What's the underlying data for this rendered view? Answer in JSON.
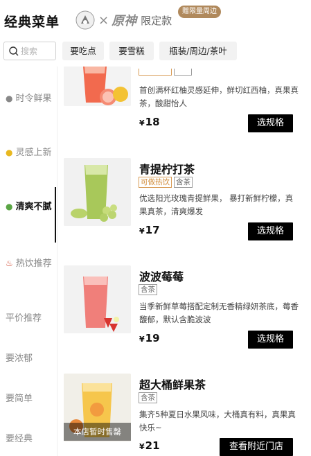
{
  "header": {
    "title": "经典菜单",
    "collab_x": "×",
    "collab_brand": "原神",
    "limited": "限定款",
    "gift_badge": "赠限量周边"
  },
  "search": {
    "placeholder": "搜索"
  },
  "filters": [
    "要吃点",
    "要雪糕",
    "瓶装/周边/茶叶"
  ],
  "sidebar": {
    "items": [
      {
        "label": "时令鲜果",
        "icon": "coconut-icon"
      },
      {
        "label": "灵感上新",
        "icon": "lightbulb-icon"
      },
      {
        "label": "清爽不腻",
        "icon": "leaf-icon",
        "active": true
      },
      {
        "label": "热饮推荐",
        "icon": "hot-steam-icon"
      },
      {
        "label": "平价推荐"
      },
      {
        "label": "要浓郁"
      },
      {
        "label": "要简单"
      },
      {
        "label": "要经典"
      }
    ]
  },
  "products": [
    {
      "name": "",
      "tags": [],
      "desc": "首创满杯红柚灵感延伸，鲜切红西柚，真果真茶，酸甜怡人",
      "currency": "¥",
      "price": "18",
      "button": "选规格"
    },
    {
      "name": "青提柠打茶",
      "tags": [
        {
          "text": "可做热饮",
          "style": "orange"
        },
        {
          "text": "含茶",
          "style": "gray"
        }
      ],
      "desc": "优选阳光玫瑰青提鲜果， 暴打新鲜柠檬，真果真茶，清爽爆发",
      "currency": "¥",
      "price": "17",
      "button": "选规格"
    },
    {
      "name": "波波莓莓",
      "tags": [
        {
          "text": "含茶",
          "style": "gray"
        }
      ],
      "desc": "当季新鲜草莓搭配定制无香精绿妍茶底，莓香馥郁，默认含脆波波",
      "currency": "¥",
      "price": "19",
      "button": "选规格"
    },
    {
      "name": "超大桶鲜果茶",
      "tags": [
        {
          "text": "含茶",
          "style": "gray"
        }
      ],
      "desc": "集齐5种夏日水果风味，大桶真有料，真果真快乐~",
      "currency": "¥",
      "price": "21",
      "button": "查看附近门店",
      "soldout": "本店暂时售罄"
    }
  ],
  "colors": {
    "accent_gold": "#b0895c",
    "tag_orange": "#d08a36",
    "button_black": "#000000"
  }
}
